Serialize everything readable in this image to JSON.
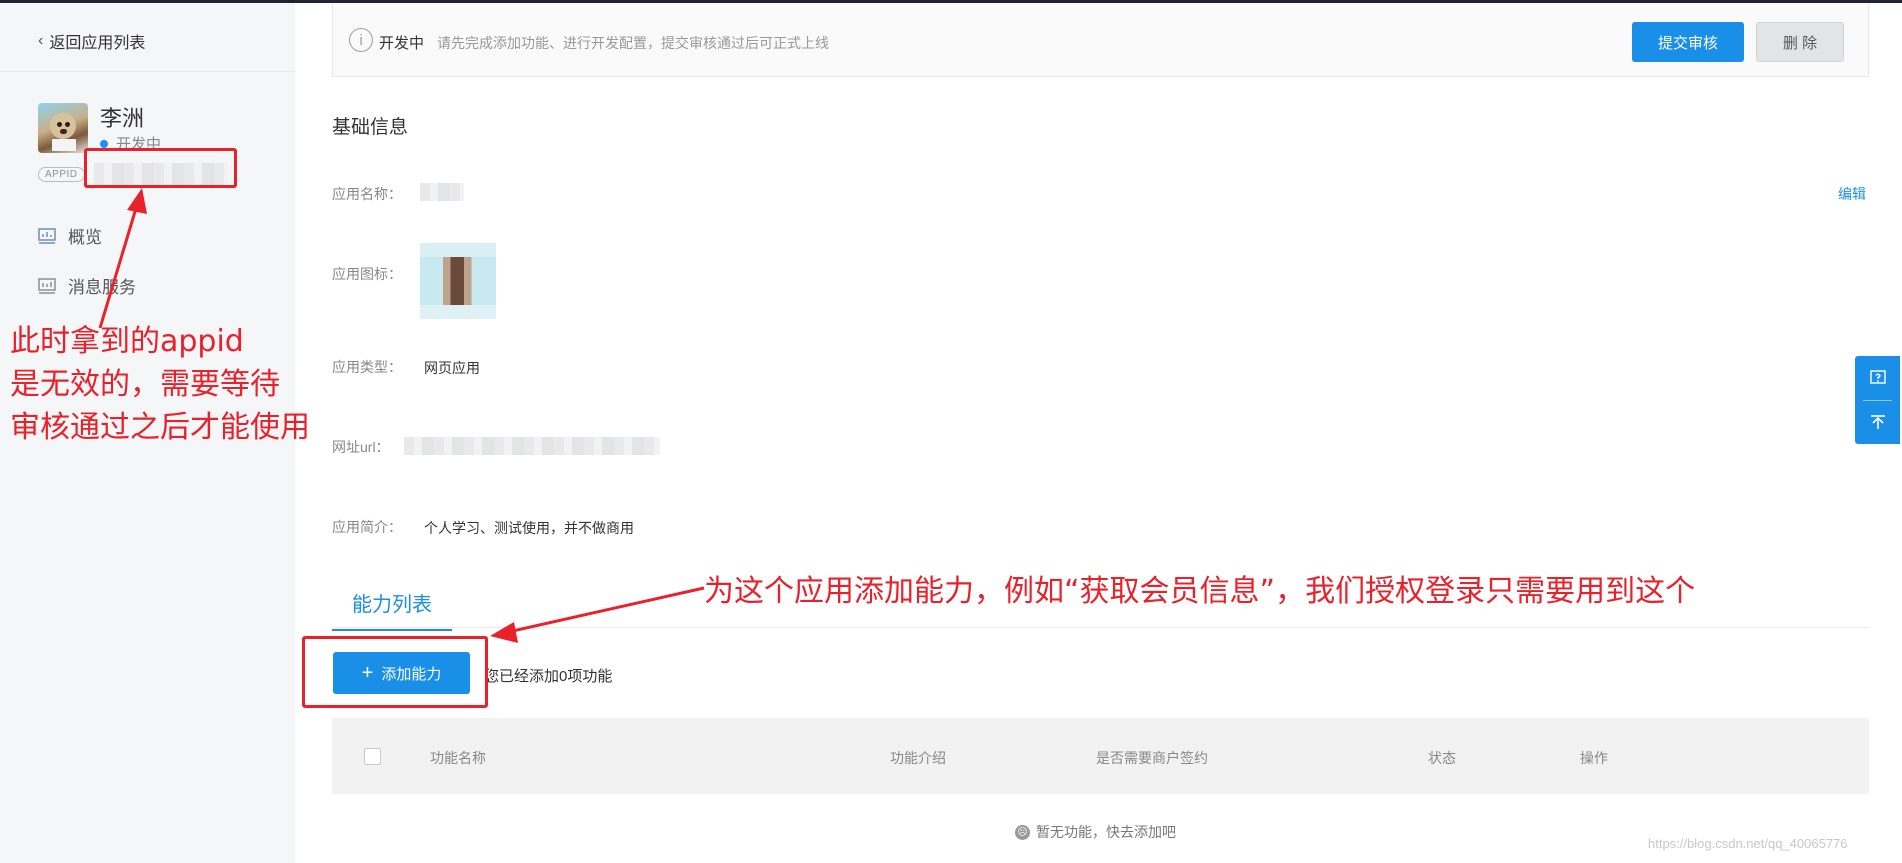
{
  "sidebar": {
    "back_label": "返回应用列表",
    "app": {
      "name": "李洲",
      "status": "开发中",
      "appid_tag": "APPID"
    },
    "nav": [
      {
        "label": "概览",
        "icon": "chart-icon"
      },
      {
        "label": "消息服务",
        "icon": "message-icon"
      }
    ]
  },
  "notice": {
    "status_label": "开发中",
    "description": "请先完成添加功能、进行开发配置，提交审核通过后可正式上线",
    "submit_label": "提交审核",
    "delete_label": "删 除"
  },
  "basic_info": {
    "title": "基础信息",
    "edit_label": "编辑",
    "fields": {
      "name_label": "应用名称：",
      "icon_label": "应用图标：",
      "type_label": "应用类型：",
      "type_value": "网页应用",
      "url_label": "网址url：",
      "intro_label": "应用简介：",
      "intro_value": "个人学习、测试使用，并不做商用"
    }
  },
  "abilities": {
    "tab_label": "能力列表",
    "add_label": "添加能力",
    "added_count_text": "您已经添加0项功能",
    "columns": [
      "功能名称",
      "功能介绍",
      "是否需要商户签约",
      "状态",
      "操作"
    ],
    "empty_text": "暂无功能，快去添加吧"
  },
  "annotations": {
    "left_lines": [
      "此时拿到的appid",
      "是无效的，需要等待",
      "审核通过之后才能使用"
    ],
    "right_text": "为这个应用添加能力，例如“获取会员信息”，我们授权登录只需要用到这个"
  },
  "watermark": "https://blog.csdn.net/qq_40065776",
  "colors": {
    "primary": "#1a8fe8",
    "annotation": "#e8212a",
    "sidebar_bg": "#f5f6f8"
  }
}
